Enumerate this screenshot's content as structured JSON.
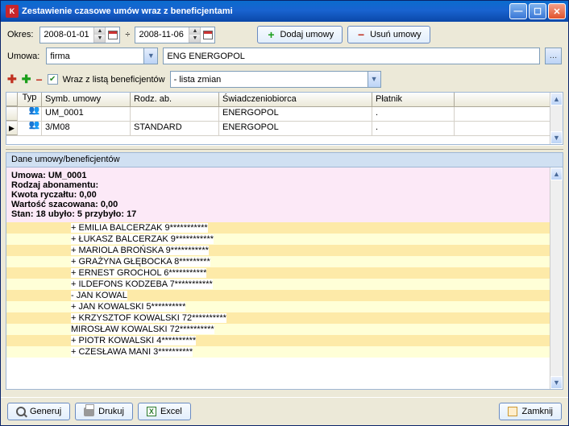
{
  "titlebar": {
    "text": "Zestawienie czasowe umów wraz z beneficjentami"
  },
  "toolbar": {
    "okres_label": "Okres:",
    "date_from": "2008-01-01",
    "date_to": "2008-11-06",
    "date_sep": "÷",
    "add_btn": "Dodaj umowy",
    "del_btn": "Usuń umowy",
    "umowa_label": "Umowa:",
    "umowa_value": "firma",
    "company": "ENG ENERGOPOL",
    "benef_label": "Wraz z listą beneficjentów",
    "mode_value": "- lista zmian"
  },
  "grid": {
    "headers": {
      "typ": "Typ",
      "symb": "Symb. umowy",
      "rodz": "Rodz. ab.",
      "sw": "Świadczeniobiorca",
      "plat": "Płatnik"
    },
    "rows": [
      {
        "symb": "UM_0001",
        "rodz": "",
        "sw": "ENERGOPOL",
        "plat": "."
      },
      {
        "symb": "3/M08",
        "rodz": "STANDARD",
        "sw": "ENERGOPOL",
        "plat": "."
      }
    ]
  },
  "detail": {
    "pane_title": "Dane umowy/beneficjentów",
    "lines": {
      "l1a": "Umowa: ",
      "l1b": "UM_0001",
      "l2": "Rodzaj abonamentu:",
      "l3a": "Kwota ryczałtu: ",
      "l3b": "0,00",
      "l4a": "Wartość szacowana: ",
      "l4b": "0,00",
      "l5a": "Stan: ",
      "l5b": "18",
      "l5c": " ubyło: ",
      "l5d": "5",
      "l5e": " przybyło: ",
      "l5f": "17"
    },
    "beneficiaries": [
      "+ EMILIA BALCERZAK 9***********",
      "+ ŁUKASZ BALCERZAK 9***********",
      "+ MARIOLA BROŃSKA 9***********",
      "+ GRAŻYNA GŁĘBOCKA 8*********",
      "+ ERNEST GROCHOL 6***********",
      "+ ILDEFONS KODZEBA 7***********",
      "- JAN KOWAL",
      "+ JAN KOWALSKI 5**********",
      "+ KRZYSZTOF KOWALSKI 72**********",
      "  MIROSŁAW KOWALSKI 72**********",
      "+ PIOTR KOWALSKI 4**********",
      "+ CZESŁAWA MANI 3**********"
    ]
  },
  "footer": {
    "gen": "Generuj",
    "print": "Drukuj",
    "excel": "Excel",
    "close": "Zamknij"
  }
}
